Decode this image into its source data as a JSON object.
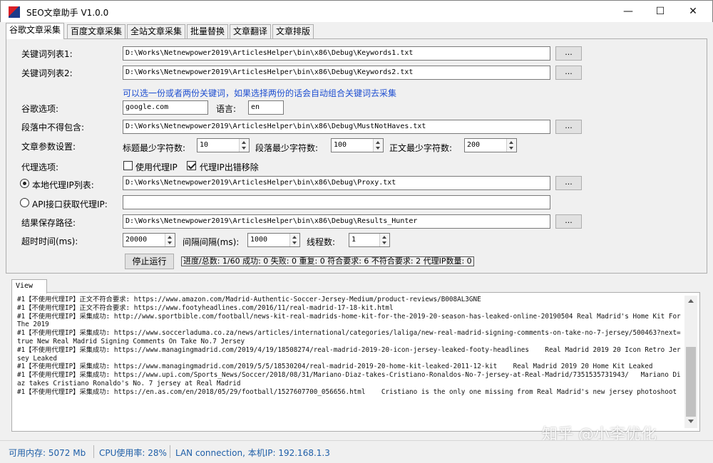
{
  "window": {
    "title": "SEO文章助手 V1.0.0",
    "minimize": "—",
    "maximize": "☐",
    "close": "✕"
  },
  "tabs": [
    "谷歌文章采集",
    "百度文章采集",
    "全站文章采集",
    "批量替换",
    "文章翻译",
    "文章排版"
  ],
  "form": {
    "kw1_label": "关键词列表1:",
    "kw1_value": "D:\\Works\\Netnewpower2019\\ArticlesHelper\\bin\\x86\\Debug\\Keywords1.txt",
    "kw2_label": "关键词列表2:",
    "kw2_value": "D:\\Works\\Netnewpower2019\\ArticlesHelper\\bin\\x86\\Debug\\Keywords2.txt",
    "browse_label": "...",
    "hint": "可以选一份或者两份关键词，如果选择两份的话会自动组合关键词去采集",
    "google_label": "谷歌选项:",
    "google_value": "google.com",
    "lang_label": "语言:",
    "lang_value": "en",
    "exclude_label": "段落中不得包含:",
    "exclude_value": "D:\\Works\\Netnewpower2019\\ArticlesHelper\\bin\\x86\\Debug\\MustNotHaves.txt",
    "params_label": "文章参数设置:",
    "title_min_label": "标题最少字符数:",
    "title_min_value": "10",
    "para_min_label": "段落最少字符数:",
    "para_min_value": "100",
    "body_min_label": "正文最少字符数:",
    "body_min_value": "200",
    "proxy_label": "代理选项:",
    "use_proxy_label": "使用代理IP",
    "use_proxy_checked": false,
    "remove_bad_proxy_label": "代理IP出错移除",
    "remove_bad_proxy_checked": true,
    "local_proxy_label": "本地代理IP列表:",
    "local_proxy_value": "D:\\Works\\Netnewpower2019\\ArticlesHelper\\bin\\x86\\Debug\\Proxy.txt",
    "api_proxy_label": "API接口获取代理IP:",
    "api_proxy_value": "",
    "save_label": "结果保存路径:",
    "save_value": "D:\\Works\\Netnewpower2019\\ArticlesHelper\\bin\\x86\\Debug\\Results_Hunter",
    "timeout_label": "超时时间(ms):",
    "timeout_value": "20000",
    "interval_label": "间隔间隔(ms):",
    "interval_value": "1000",
    "threads_label": "线程数:",
    "threads_value": "1",
    "stop_label": "停止运行",
    "progress_text": "进度/总数: 1/60 成功: 0 失败: 0 重复: 0 符合要求: 6 不符合要求: 2 代理IP数量: 0"
  },
  "view": {
    "tab_label": "View",
    "log": [
      "#1【不使用代理IP】正文不符合要求: https://www.amazon.com/Madrid-Authentic-Soccer-Jersey-Medium/product-reviews/B008AL3GNE",
      "#1【不使用代理IP】正文不符合要求: https://www.footyheadlines.com/2016/11/real-madrid-17-18-kit.html",
      "#1【不使用代理IP】采集成功: http://www.sportbible.com/football/news-kit-real-madrids-home-kit-for-the-2019-20-season-has-leaked-online-20190504 Real Madrid's Home Kit For The 2019",
      "#1【不使用代理IP】采集成功: https://www.soccerladuma.co.za/news/articles/international/categories/laliga/new-real-madrid-signing-comments-on-take-no-7-jersey/500463?next=true New Real Madrid Signing Comments On Take No.7 Jersey",
      "#1【不使用代理IP】采集成功: https://www.managingmadrid.com/2019/4/19/18508274/real-madrid-2019-20-icon-jersey-leaked-footy-headlines    Real Madrid 2019 20 Icon Retro Jersey Leaked",
      "#1【不使用代理IP】采集成功: https://www.managingmadrid.com/2019/5/5/18530204/real-madrid-2019-20-home-kit-leaked-2011-12-kit    Real Madrid 2019 20 Home Kit Leaked",
      "#1【不使用代理IP】采集成功: https://www.upi.com/Sports_News/Soccer/2018/08/31/Mariano-Diaz-takes-Cristiano-Ronaldos-No-7-jersey-at-Real-Madrid/7351535731943/   Mariano Diaz takes Cristiano Ronaldo's No. 7 jersey at Real Madrid",
      "#1【不使用代理IP】采集成功: https://en.as.com/en/2018/05/29/football/1527607700_056656.html    Cristiano is the only one missing from Real Madrid's new jersey photoshoot"
    ]
  },
  "watermark": "知乎 @小李优化",
  "status": {
    "memory": "可用内存: 5072 Mb",
    "cpu": "CPU使用率: 28%",
    "network": "LAN connection, 本机IP: 192.168.1.3"
  },
  "colors": {
    "hint": "#1f4fd1",
    "status_text": "#1f5fa8"
  }
}
